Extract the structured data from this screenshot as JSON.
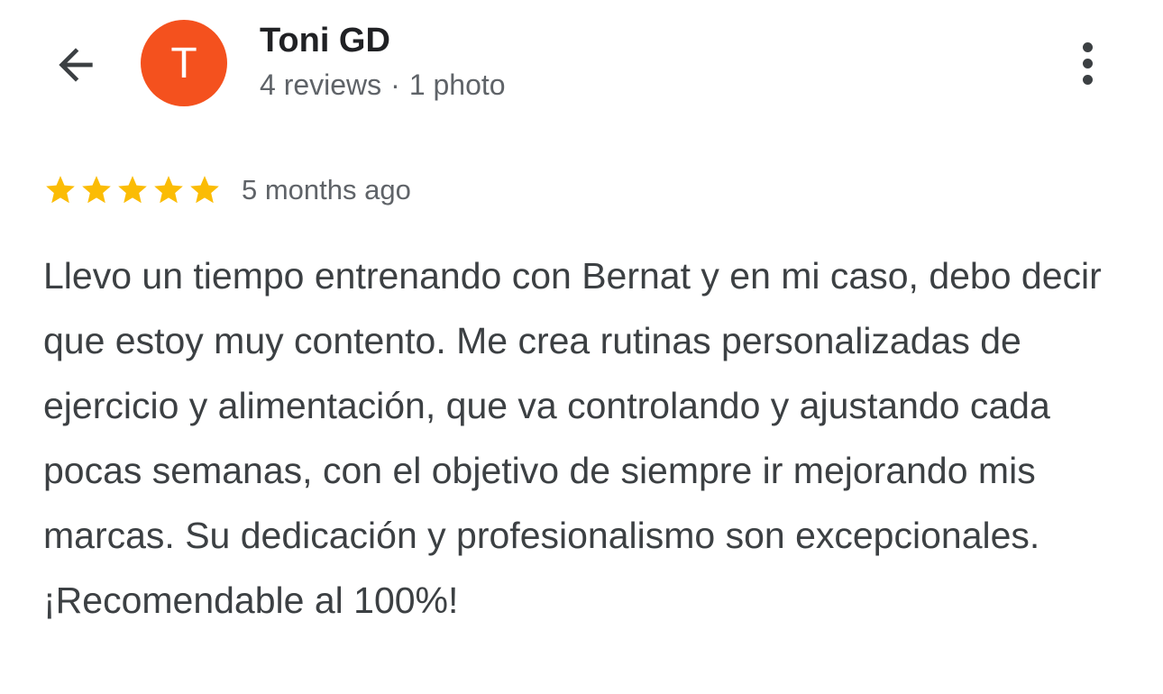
{
  "header": {
    "back_icon": "arrow-back-icon",
    "more_icon": "more-vert-icon"
  },
  "reviewer": {
    "initial": "T",
    "avatar_color": "#f4511e",
    "name": "Toni GD",
    "reviews_count": "4 reviews",
    "separator": "·",
    "photos_count": "1 photo"
  },
  "review": {
    "rating": 5,
    "rating_max": 5,
    "star_color": "#fbbc04",
    "time": "5 months ago",
    "text": "Llevo un tiempo entrenando con Bernat y en mi caso, debo decir que estoy muy contento. Me crea rutinas personalizadas de ejercicio y alimentación, que va controlando y ajustando cada pocas semanas, con el objetivo de siempre ir mejorando mis marcas. Su dedicación y profesionalismo son excepcionales. ¡Recomendable al 100%!"
  }
}
